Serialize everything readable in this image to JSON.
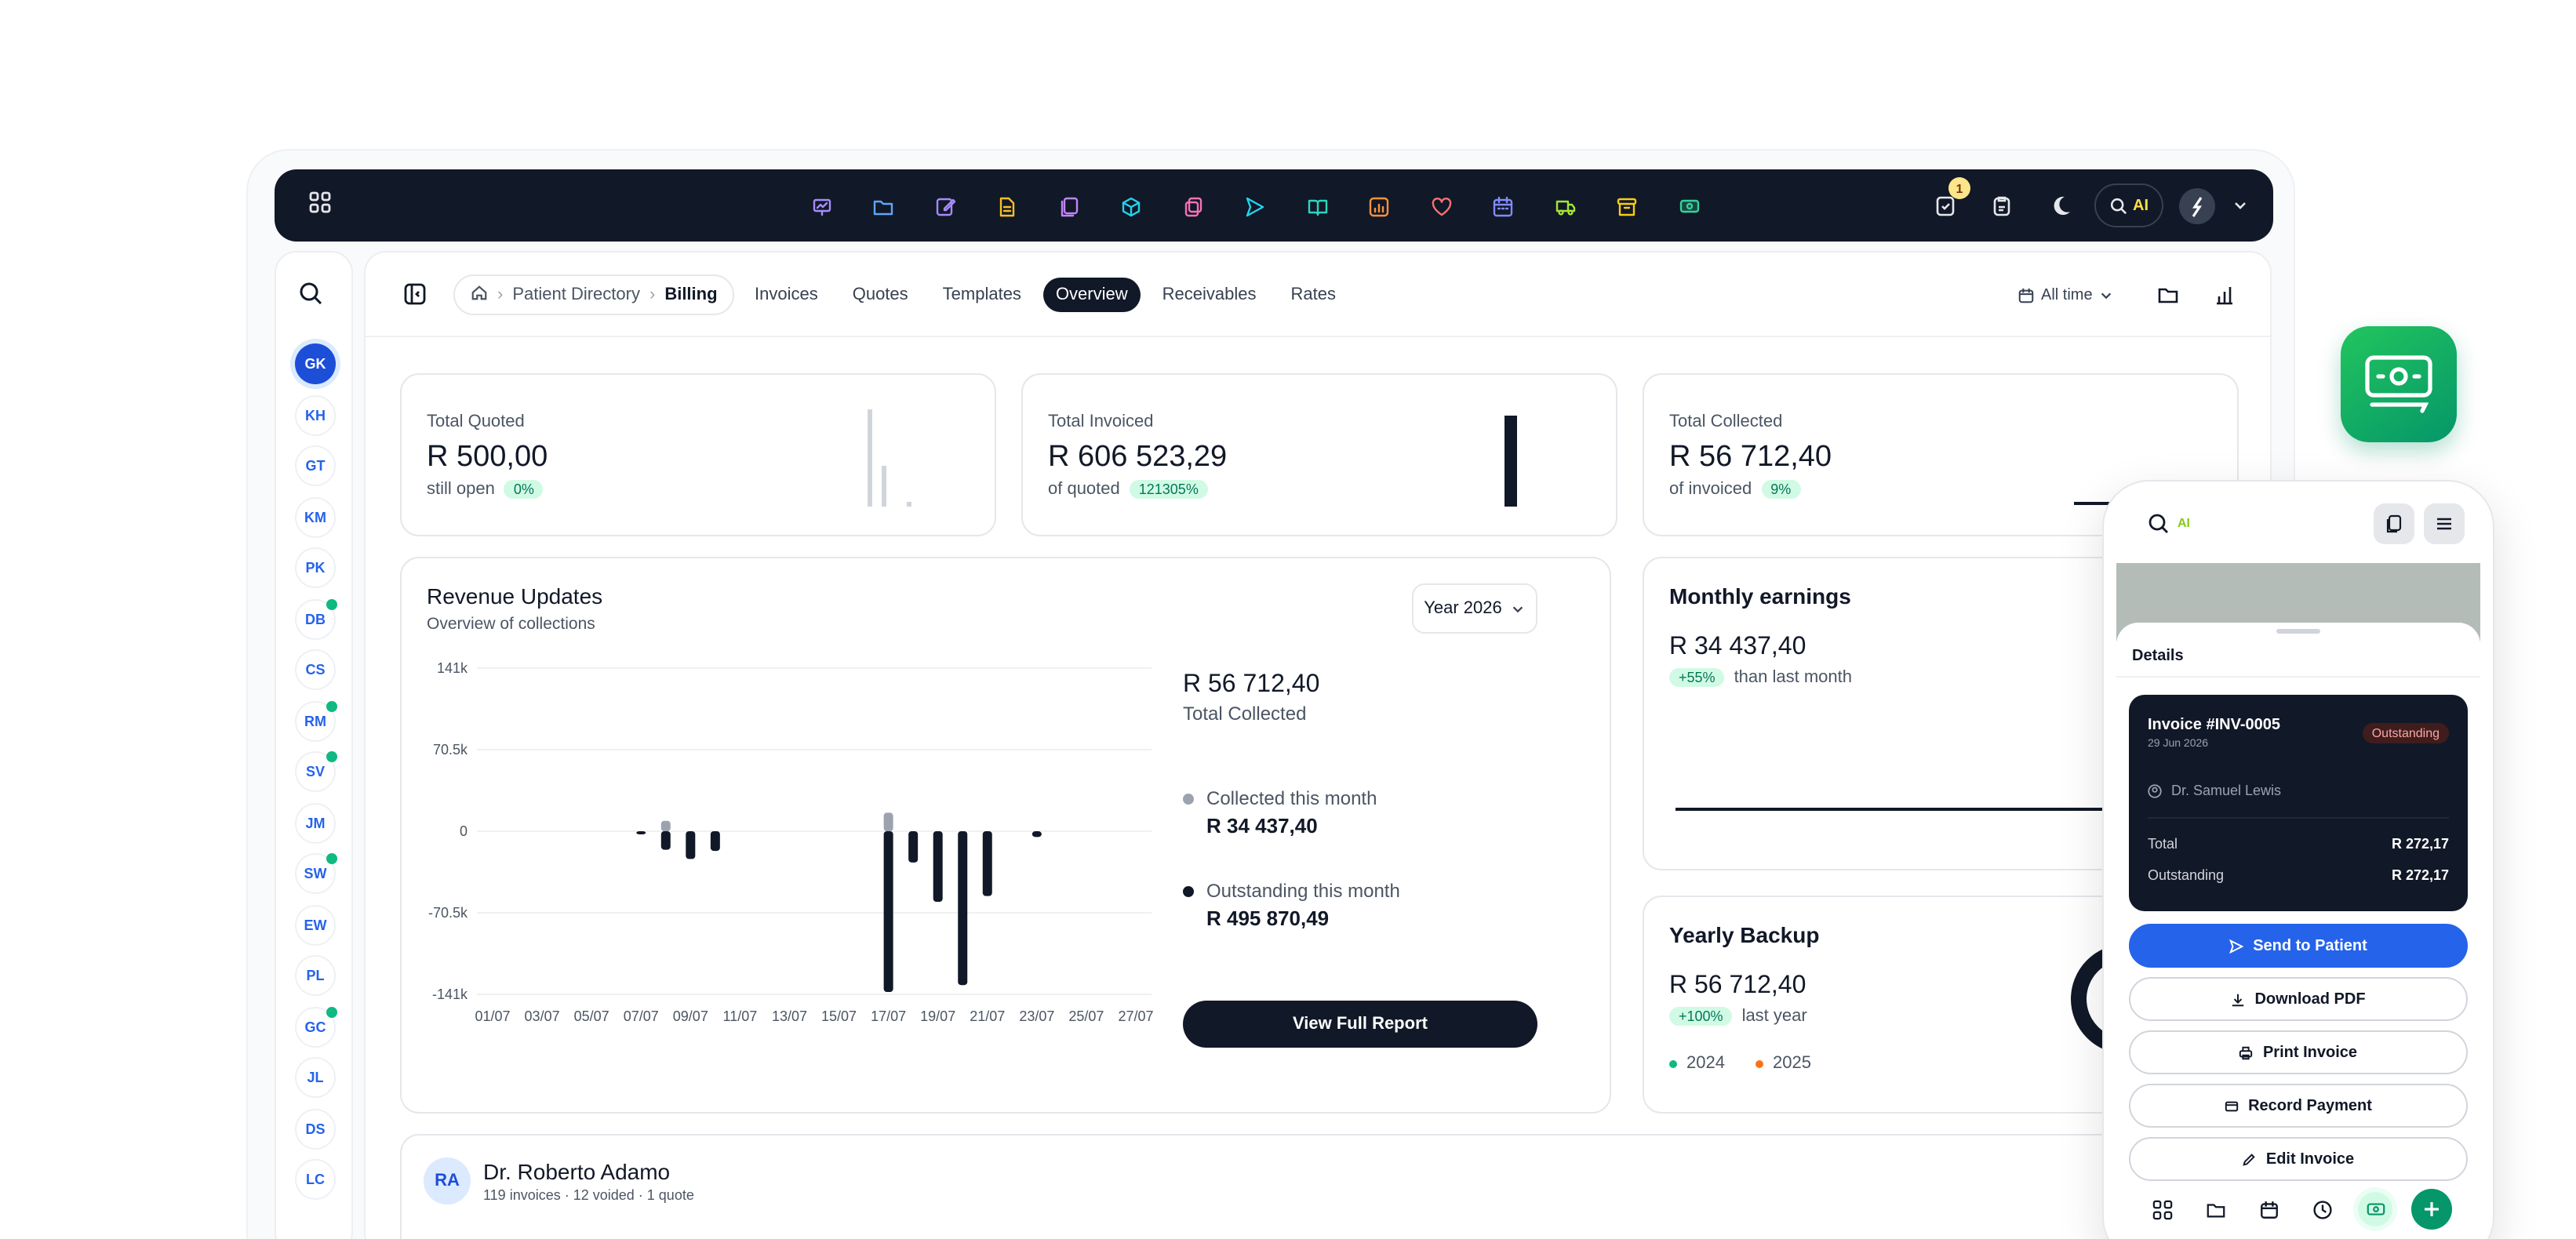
{
  "topbar": {
    "notification_count": "1",
    "ai_label": "AI",
    "app_icons": [
      {
        "name": "presentation-icon",
        "color": "#a78bfa"
      },
      {
        "name": "folder-icon",
        "color": "#60a5fa"
      },
      {
        "name": "edit-icon",
        "color": "#a78bfa"
      },
      {
        "name": "document-icon",
        "color": "#fbbf24"
      },
      {
        "name": "files-icon",
        "color": "#c084fc"
      },
      {
        "name": "cube-icon",
        "color": "#22d3ee"
      },
      {
        "name": "copy-icon",
        "color": "#f472b6"
      },
      {
        "name": "send-icon",
        "color": "#22d3ee"
      },
      {
        "name": "book-icon",
        "color": "#2dd4bf"
      },
      {
        "name": "chart-icon",
        "color": "#fb923c"
      },
      {
        "name": "heart-icon",
        "color": "#f87171"
      },
      {
        "name": "calendar-icon",
        "color": "#818cf8"
      },
      {
        "name": "truck-icon",
        "color": "#a3e635"
      },
      {
        "name": "archive-icon",
        "color": "#facc15"
      },
      {
        "name": "money-icon",
        "color": "#34d399"
      }
    ]
  },
  "sidebar": {
    "avatars": [
      {
        "initials": "GK",
        "selected": true,
        "online": false
      },
      {
        "initials": "KH",
        "selected": false,
        "online": false
      },
      {
        "initials": "GT",
        "selected": false,
        "online": false
      },
      {
        "initials": "KM",
        "selected": false,
        "online": false
      },
      {
        "initials": "PK",
        "selected": false,
        "online": false
      },
      {
        "initials": "DB",
        "selected": false,
        "online": true
      },
      {
        "initials": "CS",
        "selected": false,
        "online": false
      },
      {
        "initials": "RM",
        "selected": false,
        "online": true
      },
      {
        "initials": "SV",
        "selected": false,
        "online": true
      },
      {
        "initials": "JM",
        "selected": false,
        "online": false
      },
      {
        "initials": "SW",
        "selected": false,
        "online": true
      },
      {
        "initials": "EW",
        "selected": false,
        "online": false
      },
      {
        "initials": "PL",
        "selected": false,
        "online": false
      },
      {
        "initials": "GC",
        "selected": false,
        "online": true
      },
      {
        "initials": "JL",
        "selected": false,
        "online": false
      },
      {
        "initials": "DS",
        "selected": false,
        "online": false
      },
      {
        "initials": "LC",
        "selected": false,
        "online": false
      }
    ]
  },
  "header": {
    "breadcrumb": {
      "parent": "Patient Directory",
      "current": "Billing"
    },
    "tabs": [
      "Invoices",
      "Quotes",
      "Templates",
      "Overview",
      "Receivables",
      "Rates"
    ],
    "active_tab": "Overview",
    "range": "All time"
  },
  "kpis": {
    "quoted": {
      "label": "Total Quoted",
      "value": "R 500,00",
      "sub": "still open",
      "pill": "0%"
    },
    "invoiced": {
      "label": "Total Invoiced",
      "value": "R 606 523,29",
      "sub": "of quoted",
      "pill": "121305%"
    },
    "collected": {
      "label": "Total Collected",
      "value": "R 56 712,40",
      "sub": "of invoiced",
      "pill": "9%"
    }
  },
  "revenue": {
    "title": "Revenue Updates",
    "subtitle": "Overview of collections",
    "year": "Year 2026",
    "total_value": "R 56 712,40",
    "total_label": "Total Collected",
    "collected_label": "Collected this month",
    "collected_value": "R 34 437,40",
    "outstanding_label": "Outstanding this month",
    "outstanding_value": "R 495 870,49",
    "button": "View Full Report"
  },
  "chart_data": {
    "type": "bar",
    "y_ticks": [
      "141k",
      "70.5k",
      "0",
      "-70.5k",
      "-141k"
    ],
    "ylim": [
      -141000,
      141000
    ],
    "categories": [
      "01/07",
      "02/07",
      "03/07",
      "04/07",
      "05/07",
      "06/07",
      "07/07",
      "08/07",
      "09/07",
      "10/07",
      "11/07",
      "12/07",
      "13/07",
      "14/07",
      "15/07",
      "16/07",
      "17/07",
      "18/07",
      "19/07",
      "20/07",
      "21/07",
      "22/07",
      "23/07",
      "24/07",
      "25/07",
      "26/07",
      "27/07"
    ],
    "x_tick_labels": [
      "01/07",
      "03/07",
      "05/07",
      "07/07",
      "09/07",
      "11/07",
      "13/07",
      "15/07",
      "17/07",
      "19/07",
      "21/07",
      "23/07",
      "25/07",
      "27/07"
    ],
    "series": [
      {
        "name": "Collected this month",
        "color": "#9ca3af",
        "values": [
          0,
          0,
          0,
          0,
          0,
          0,
          0,
          9000,
          0,
          0,
          0,
          0,
          0,
          0,
          0,
          0,
          16000,
          0,
          0,
          0,
          0,
          0,
          0,
          0,
          0,
          0,
          0
        ]
      },
      {
        "name": "Outstanding this month",
        "color": "#111827",
        "values": [
          0,
          0,
          0,
          0,
          0,
          0,
          -1000,
          -16000,
          -24000,
          -17000,
          0,
          0,
          0,
          0,
          0,
          0,
          -139000,
          -27000,
          -61000,
          -133000,
          -56000,
          0,
          -5000,
          0,
          0,
          0,
          0
        ]
      }
    ]
  },
  "monthly": {
    "title": "Monthly earnings",
    "value": "R 34 437,40",
    "pill": "+55%",
    "sub": "than last month"
  },
  "yearly": {
    "title": "Yearly Backup",
    "value": "R 56 712,40",
    "pill": "+100%",
    "sub": "last year",
    "legend": [
      "2024",
      "2025"
    ],
    "colors": [
      "#10b981",
      "#f97316"
    ]
  },
  "patient": {
    "initials": "RA",
    "name": "Dr. Roberto Adamo",
    "meta": "119 invoices · 12 voided · 1 quote"
  },
  "phone": {
    "ai_label": "AI",
    "sheet_title": "Details",
    "invoice": {
      "title": "Invoice #INV-0005",
      "date": "29 Jun 2026",
      "status": "Outstanding",
      "doctor": "Dr. Samuel Lewis",
      "total_label": "Total",
      "total": "R 272,17",
      "outstanding_label": "Outstanding",
      "outstanding": "R 272,17"
    },
    "buttons": [
      "Send to Patient",
      "Download PDF",
      "Print Invoice",
      "Record Payment",
      "Edit Invoice"
    ]
  }
}
